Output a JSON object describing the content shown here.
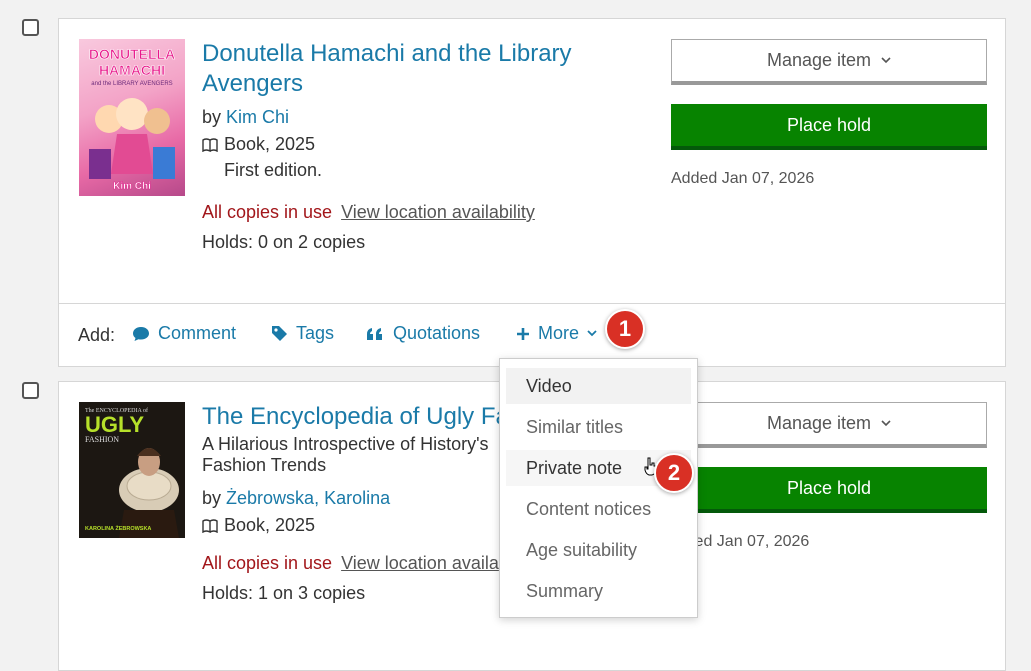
{
  "items": [
    {
      "title_line1": "Donutella Hamachi and the Library",
      "title_line2": "Avengers",
      "by": "by",
      "author": "Kim Chi",
      "format": "Book, 2025",
      "edition": "First edition.",
      "status": "All copies in use",
      "availability_link": "View location availability",
      "holds": "Holds: 0 on 2 copies",
      "manage_label": "Manage item",
      "hold_label": "Place hold",
      "added": "Added Jan 07, 2026",
      "cover_title": "DONUTELLA HAMACHI",
      "cover_subtitle": "and the LIBRARY AVENGERS",
      "cover_author": "Kim Chi"
    },
    {
      "title": "The Encyclopedia of Ugly Fas",
      "subtitle_line1": "A Hilarious Introspective of History's",
      "subtitle_line2": "Fashion Trends",
      "by": "by",
      "author": "Żebrowska, Karolina",
      "format": "Book, 2025",
      "status": "All copies in use",
      "availability_link": "View location availa",
      "holds": "Holds: 1 on 3 copies",
      "manage_label": "Manage item",
      "hold_label": "Place hold",
      "added": "led Jan 07, 2026",
      "cover_top": "The ENCYCLOPEDIA of",
      "cover_title": "UGLY",
      "cover_sub": "FASHION",
      "cover_author": "KAROLINA ŻEBROWSKA"
    }
  ],
  "footer": {
    "add_label": "Add:",
    "comment": "Comment",
    "tags": "Tags",
    "quotations": "Quotations",
    "more": "More"
  },
  "more_menu": {
    "options": [
      "Video",
      "Similar titles",
      "Private note",
      "Content notices",
      "Age suitability",
      "Summary"
    ]
  },
  "badges": [
    "1",
    "2"
  ],
  "colors": {
    "link": "#1a7aa8",
    "hold_button": "#078300",
    "status_red": "#a2161a",
    "badge": "#d93025"
  }
}
